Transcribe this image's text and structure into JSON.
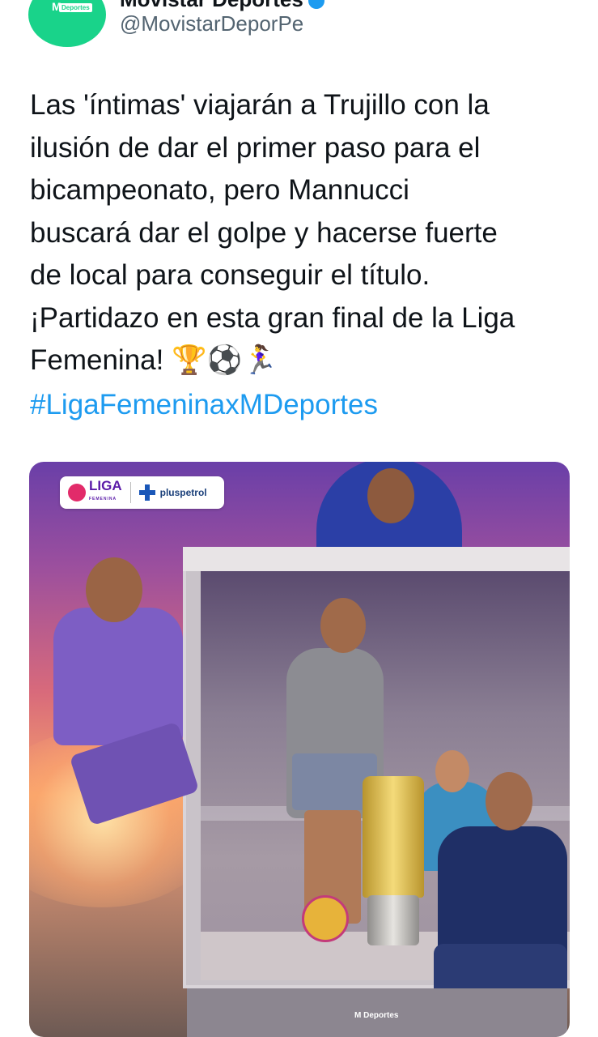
{
  "tweet": {
    "display_name": "Movistar Deportes",
    "handle": "@MovistarDeporPe",
    "avatar": {
      "letter": "M",
      "tag": "Deportes",
      "color": "#19d38a"
    },
    "text": "Las 'íntimas' viajarán a Trujillo con la\nilusión de dar el primer paso para el\nbicampeonato, pero Mannucci\nbuscará dar el golpe y hacerse fuerte\nde local para conseguir el título.\n¡Partidazo en esta gran final de la Liga\nFemenina! 🏆⚽🏃‍♀️",
    "hashtag": "#LigaFemeninaxMDeportes",
    "link_color": "#1d9bf0"
  },
  "media": {
    "logo_liga": "LIGA",
    "logo_liga_sub": "FEMENINA",
    "logo_sponsor": "pluspetrol",
    "bottom_brand_letter": "M",
    "bottom_brand_text": "Deportes"
  }
}
